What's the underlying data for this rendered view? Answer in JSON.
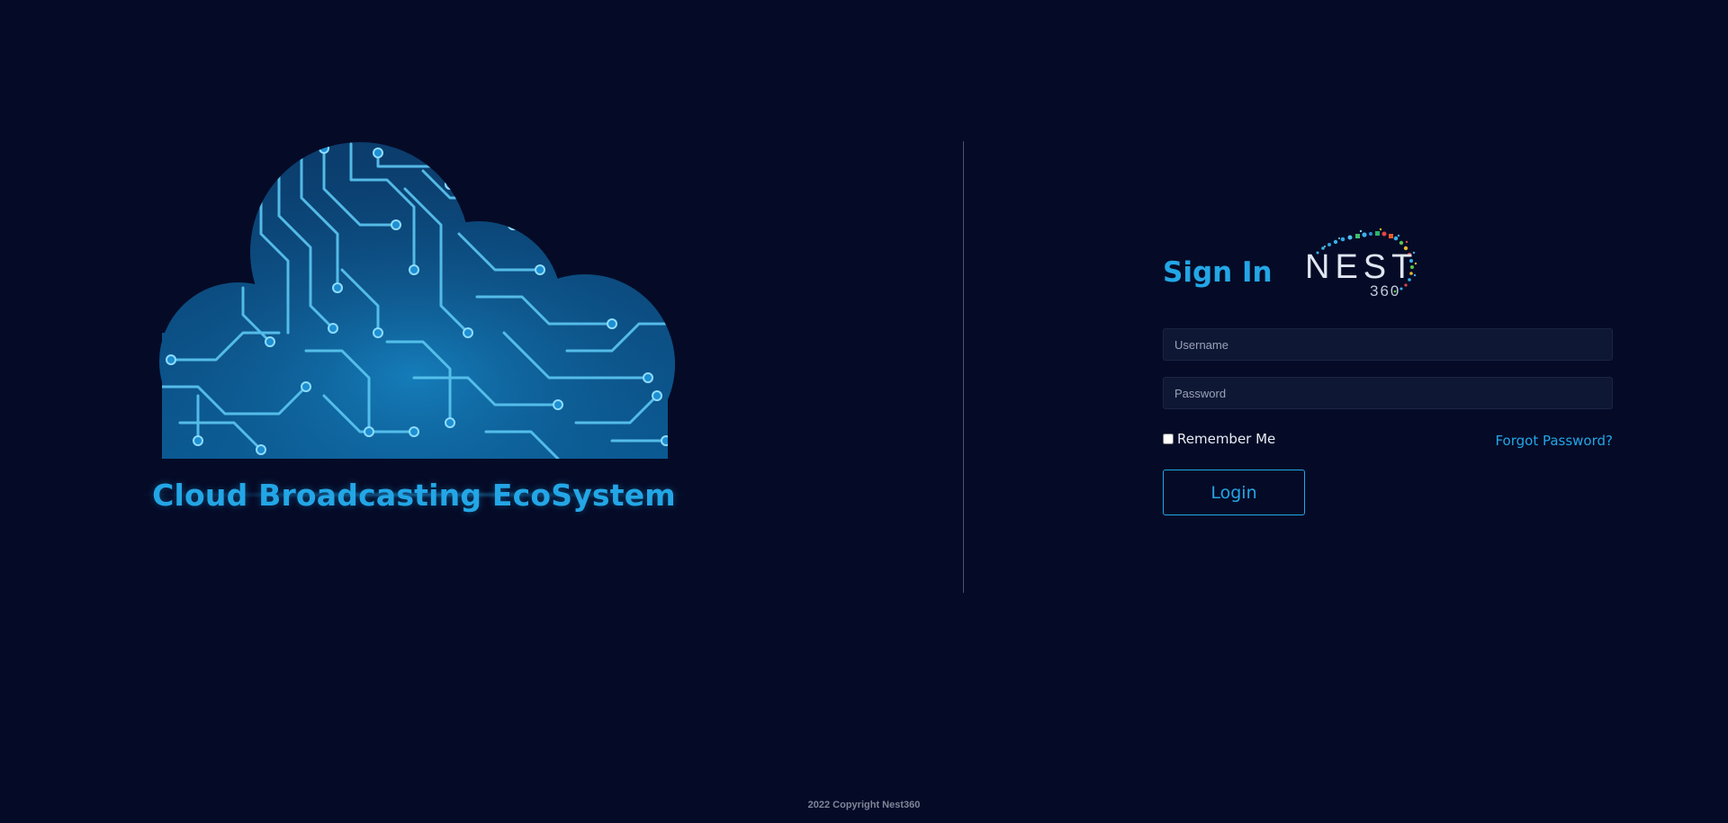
{
  "hero": {
    "tagline": "Cloud Broadcasting EcoSystem",
    "cloud_icon": "circuit-cloud-icon"
  },
  "signin": {
    "title": "Sign In",
    "logo": {
      "icon": "nest360-logo",
      "word": "NEST",
      "sub": "360"
    },
    "username_placeholder": "Username",
    "password_placeholder": "Password",
    "remember_label": "Remember Me",
    "remember_checked": false,
    "forgot_label": "Forgot Password?",
    "login_label": "Login"
  },
  "footer": {
    "copyright": "2022 Copyright Nest360"
  },
  "colors": {
    "background": "#050b27",
    "accent": "#23a6e6",
    "field_bg": "#0e1733",
    "divider": "#4a5370"
  }
}
